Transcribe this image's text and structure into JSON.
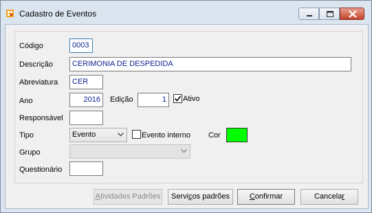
{
  "window": {
    "title": "Cadastro de Eventos",
    "icon": "app-icon"
  },
  "form": {
    "codigo_label": "Código",
    "codigo_value": "0003",
    "descricao_label": "Descrição",
    "descricao_value": "CERIMONIA DE DESPEDIDA",
    "abreviatura_label": "Abreviatura",
    "abreviatura_value": "CER",
    "ano_label": "Ano",
    "ano_value": "2016",
    "edicao_label": "Edição",
    "edicao_value": "1",
    "ativo_label": "Ativo",
    "ativo_checked": true,
    "responsavel_label": "Responsável",
    "responsavel_value": "",
    "tipo_label": "Tipo",
    "tipo_value": "Evento",
    "evento_interno_label": "Evento interno",
    "evento_interno_checked": false,
    "cor_label": "Cor",
    "cor_value": "#00ff00",
    "grupo_label": "Grupo",
    "grupo_value": "",
    "questionario_label": "Questionário",
    "questionario_value": ""
  },
  "buttons": {
    "atividades": {
      "first": "A",
      "rest": "tividades Padrões"
    },
    "servicos": {
      "before": "Servi",
      "u": "ç",
      "after": "os padrões"
    },
    "confirmar": {
      "first": "C",
      "rest": "onfirmar"
    },
    "cancelar": {
      "before": "Cancela",
      "u": "r",
      "after": ""
    }
  }
}
